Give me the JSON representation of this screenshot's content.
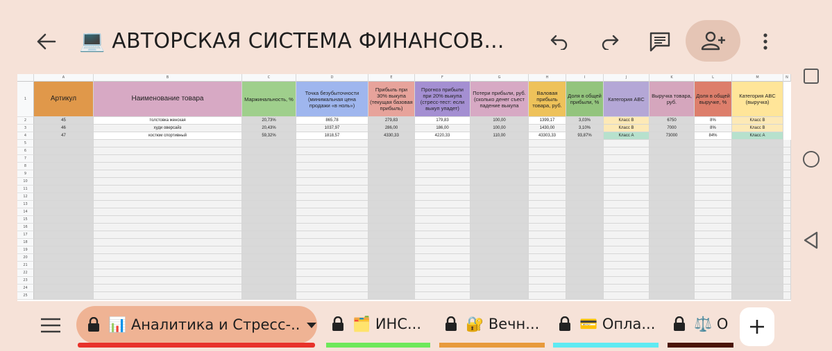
{
  "app": {
    "title_icon": "laptop-icon",
    "title": "💻 АВТОРСКАЯ СИСТЕМА ФИНАНСОВ..."
  },
  "colors": {
    "background": "#f6e2d8",
    "accent_pill": "#e5c5b5",
    "active_tab": "#efb394"
  },
  "sheet": {
    "col_letters": [
      "A",
      "B",
      "C",
      "D",
      "E",
      "F",
      "G",
      "H",
      "I",
      "J",
      "K",
      "L",
      "M",
      "N"
    ],
    "header_row_number": "1",
    "headers": [
      {
        "text": "Артикул",
        "bg": "#e0984a"
      },
      {
        "text": "Наименование товара",
        "bg": "#d7a9c4"
      },
      {
        "text": "Маржинальность, %",
        "bg": "#9fcf8c"
      },
      {
        "text": "Точка безубыточности (минимальная цена продажи «в ноль»)",
        "bg": "#9fb6ee"
      },
      {
        "text": "Прибыль при 30% выкупа (текущая базовая прибыль)",
        "bg": "#e7a39b"
      },
      {
        "text": "Прогноз прибыли при 20% выкупа (стресс-тест: если выкуп упадет)",
        "bg": "#a48fd2"
      },
      {
        "text": "Потери прибыли, руб. (сколько денег съест падение выкупа",
        "bg": "#d7a9c4"
      },
      {
        "text": "Валовая прибыль товара, руб.",
        "bg": "#eec25a"
      },
      {
        "text": "Доля в общей прибыли, %",
        "bg": "#93c47d"
      },
      {
        "text": "Категория ABC",
        "bg": "#b4a7d6"
      },
      {
        "text": "Выручка товара, руб.",
        "bg": "#d5a6bd"
      },
      {
        "text": "Доля в общей выручке, %",
        "bg": "#dd7e6b"
      },
      {
        "text": "Категория ABC (выручка)",
        "bg": "#ffe599"
      }
    ],
    "rows": [
      {
        "num": "2",
        "cells": [
          "45",
          "толстовка женская",
          "20,73%",
          "865,78",
          "279,83",
          "179,83",
          "100,00",
          "1399,17",
          "3,03%",
          "Класс B",
          "6750",
          "8%",
          "Класс B"
        ]
      },
      {
        "num": "3",
        "cells": [
          "46",
          "худи оверсайз",
          "20,43%",
          "1037,97",
          "286,00",
          "186,00",
          "100,00",
          "1430,00",
          "3,10%",
          "Класс B",
          "7000",
          "8%",
          "Класс B"
        ]
      },
      {
        "num": "4",
        "cells": [
          "47",
          "костюм спортивный",
          "59,32%",
          "1818,57",
          "4330,33",
          "4220,33",
          "110,00",
          "43303,33",
          "93,87%",
          "Класс A",
          "73000",
          "84%",
          "Класс A"
        ]
      }
    ],
    "empty_row_numbers": [
      "5",
      "6",
      "7",
      "8",
      "9",
      "10",
      "11",
      "12",
      "13",
      "14",
      "15",
      "16",
      "17",
      "18",
      "19",
      "20",
      "21",
      "22",
      "23",
      "24",
      "25"
    ]
  },
  "tabs": {
    "menu_icon": "hamburger-menu-icon",
    "active": {
      "label": "📊 Аналитика и Стресс-...",
      "underline": "#e8322a"
    },
    "others": [
      {
        "label": "🗂️ ИНС...",
        "underline": "#6ee85a"
      },
      {
        "label": "🔐 Вечн...",
        "underline": "#e89a3c"
      },
      {
        "label": "💳 Опла...",
        "underline": "#5eeaf2"
      },
      {
        "label": "⚖️ О",
        "underline": "#4a1508"
      }
    ]
  }
}
